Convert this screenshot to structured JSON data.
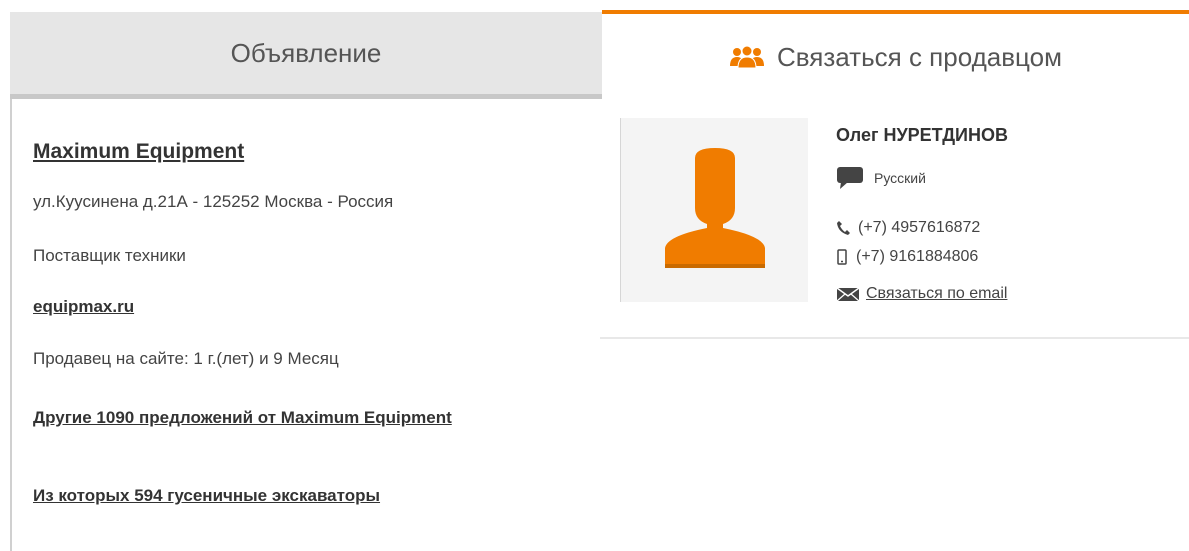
{
  "tabs": {
    "listing_label": "Объявление",
    "contact_label": "Связаться с продавцом"
  },
  "seller": {
    "company": "Maximum Equipment",
    "address": "ул.Куусинена д.21А - 125252 Москва - Россия",
    "type": "Поставщик техники",
    "website": "equipmax.ru",
    "member_since": "Продавец на сайте: 1 г.(лет) и 9 Месяц",
    "other_offers": "Другие 1090 предложений от Maximum Equipment",
    "of_which": "Из которых 594 гусеничные экскаваторы"
  },
  "contact": {
    "name": "Олег НУРЕТДИНОВ",
    "language": "Русский",
    "phone": "(+7) 4957616872",
    "mobile": "(+7) 9161884806",
    "email_label": "Связаться по email"
  },
  "colors": {
    "accent": "#f07c00",
    "tab_inactive_bg": "#e6e6e6"
  },
  "icons": {
    "contact_tab": "people-group-icon",
    "avatar": "user-silhouette-icon",
    "language": "speech-bubble-icon",
    "phone": "phone-icon",
    "mobile": "mobile-phone-icon",
    "email": "envelope-icon"
  }
}
